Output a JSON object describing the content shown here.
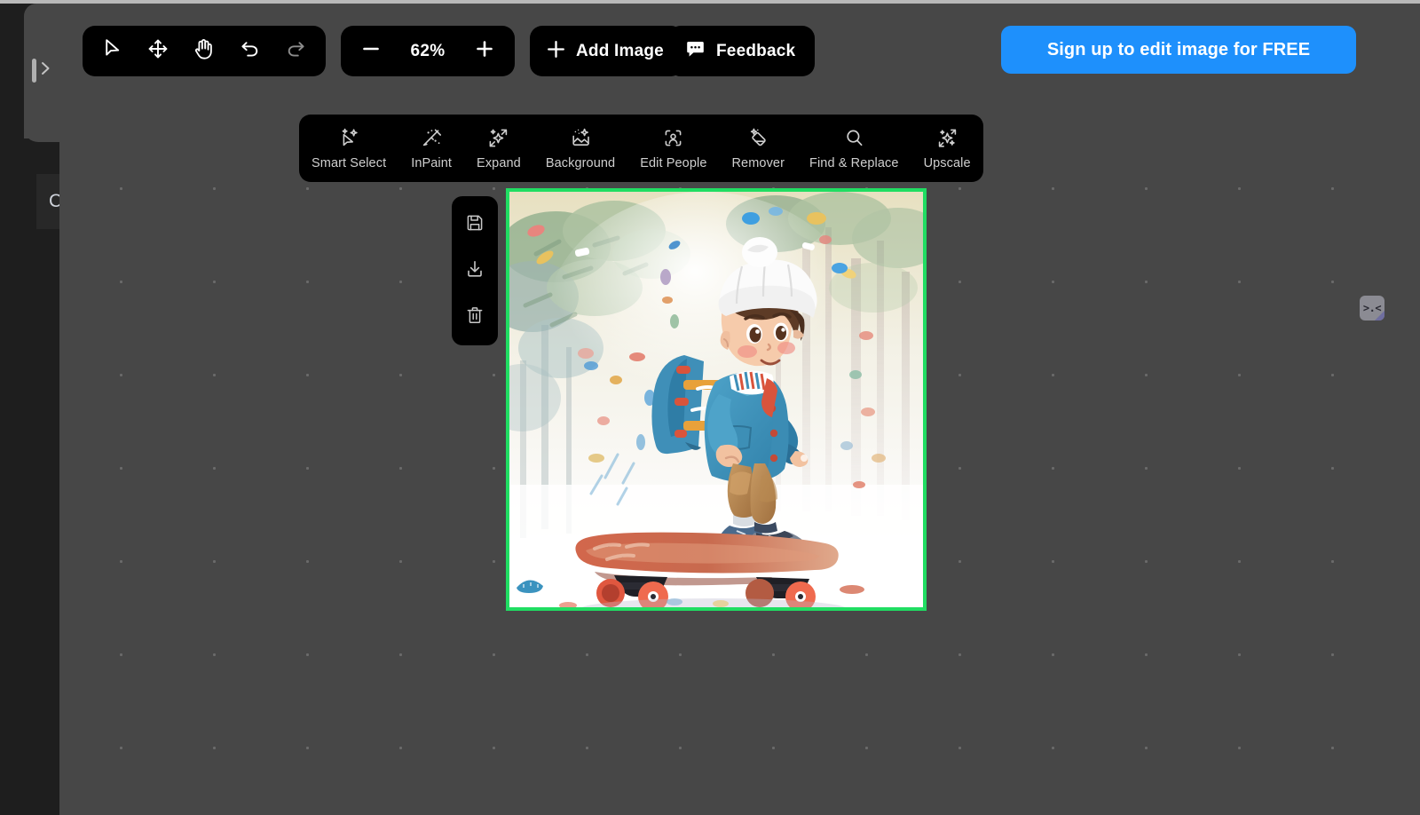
{
  "app": {
    "canvas_background": "#474747",
    "toolbar_background": "#000000",
    "accent_blue": "#1e90fc",
    "selection_green": "#20dd62"
  },
  "sidebar": {
    "toggle_icon": "panel-expand-icon",
    "hidden_panel_text": "C"
  },
  "main_tools": {
    "items": [
      {
        "id": "select",
        "icon": "cursor-arrow-icon",
        "title": "Select"
      },
      {
        "id": "move",
        "icon": "move-arrows-icon",
        "title": "Move"
      },
      {
        "id": "pan",
        "icon": "hand-icon",
        "title": "Pan"
      },
      {
        "id": "undo",
        "icon": "undo-arrow-icon",
        "title": "Undo"
      },
      {
        "id": "redo",
        "icon": "redo-arrow-icon",
        "title": "Redo"
      }
    ]
  },
  "zoom": {
    "value": "62%",
    "minus_icon": "minus-icon",
    "plus_icon": "plus-icon"
  },
  "toolbar": {
    "add_image_label": "Add Image",
    "add_image_icon": "plus-icon",
    "feedback_label": "Feedback",
    "feedback_icon": "chat-bubble-icon"
  },
  "cta": {
    "label": "Sign up to edit image for FREE"
  },
  "ai_toolbar": {
    "items": [
      {
        "label": "Smart Select",
        "icon": "smart-select-icon"
      },
      {
        "label": "InPaint",
        "icon": "magic-wand-icon"
      },
      {
        "label": "Expand",
        "icon": "expand-sparkle-icon"
      },
      {
        "label": "Background",
        "icon": "image-sparkle-icon"
      },
      {
        "label": "Edit People",
        "icon": "person-frame-icon"
      },
      {
        "label": "Remover",
        "icon": "eraser-sparkle-icon"
      },
      {
        "label": "Find & Replace",
        "icon": "search-icon"
      },
      {
        "label": "Upscale",
        "icon": "upscale-sparkle-icon"
      }
    ]
  },
  "side_toolbar": {
    "items": [
      {
        "id": "save",
        "icon": "save-floppy-icon",
        "title": "Save"
      },
      {
        "id": "download",
        "icon": "download-icon",
        "title": "Download"
      },
      {
        "id": "delete",
        "icon": "trash-icon",
        "title": "Delete"
      }
    ]
  },
  "image_object": {
    "alt": "Illustration of a young boy in a white knit beanie, blue denim jacket and colorful backpack riding a skateboard through a soft watercolor forest",
    "selected": true,
    "border_color": "#20dd62"
  },
  "right_chip": {
    "face": ">.<",
    "icon": "emoji-face-icon"
  }
}
